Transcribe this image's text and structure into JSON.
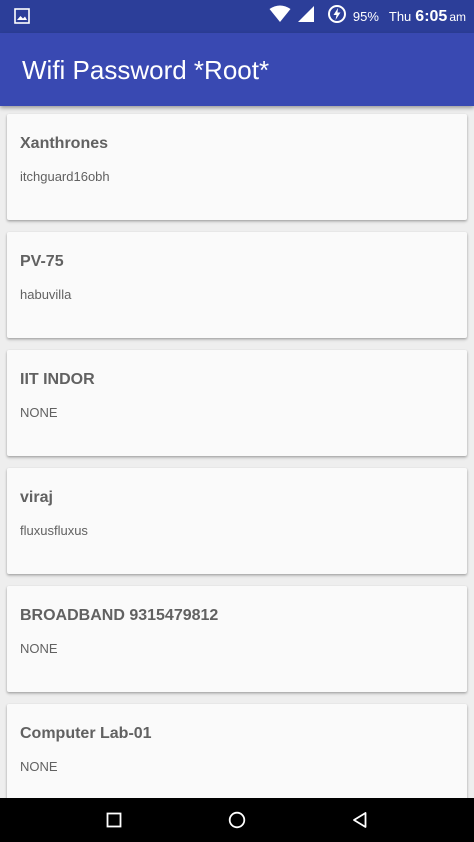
{
  "status_bar": {
    "battery": "95%",
    "day": "Thu",
    "time": "6:05",
    "ampm": "am",
    "icons": [
      "image-icon",
      "wifi-icon",
      "signal-icon",
      "battery-saver-icon"
    ]
  },
  "app_bar": {
    "title": "Wifi Password *Root*"
  },
  "networks": [
    {
      "ssid": "Xanthrones",
      "password": "itchguard16obh"
    },
    {
      "ssid": "PV-75",
      "password": "habuvilla"
    },
    {
      "ssid": "IIT INDOR",
      "password": "NONE"
    },
    {
      "ssid": "viraj",
      "password": "fluxusfluxus"
    },
    {
      "ssid": "BROADBAND 9315479812",
      "password": "NONE"
    },
    {
      "ssid": "Computer Lab-01",
      "password": "NONE"
    }
  ],
  "nav_bar": {
    "icons": [
      "recents-icon",
      "home-icon",
      "back-icon"
    ]
  },
  "colors": {
    "status_bar": "#2c3e99",
    "app_bar": "#3949b2",
    "background": "#eeeeee",
    "card": "#fafafa",
    "text": "#616161"
  }
}
